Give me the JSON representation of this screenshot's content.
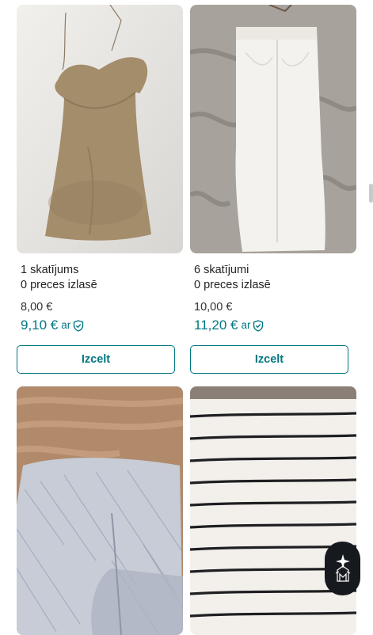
{
  "items": [
    {
      "views": "1 skatījums",
      "saves": "0 preces izlasē",
      "price": "8,00 €",
      "price_incl": "9,10 €",
      "incl_label": "ar",
      "button": "Izcelt",
      "image": "beige-dress-photo"
    },
    {
      "views": "6 skatījumi",
      "saves": "0 preces izlasē",
      "price": "10,00 €",
      "price_incl": "11,20 €",
      "incl_label": "ar",
      "button": "Izcelt",
      "image": "white-denim-skirt-photo"
    },
    {
      "image": "blue-tweed-skirt-photo"
    },
    {
      "image": "striped-top-photo"
    }
  ],
  "icons": {
    "shield": "shield-check-icon",
    "fab": "sparkle-robot-icon"
  },
  "colors": {
    "accent": "#007782",
    "fab_bg": "#16191d"
  }
}
